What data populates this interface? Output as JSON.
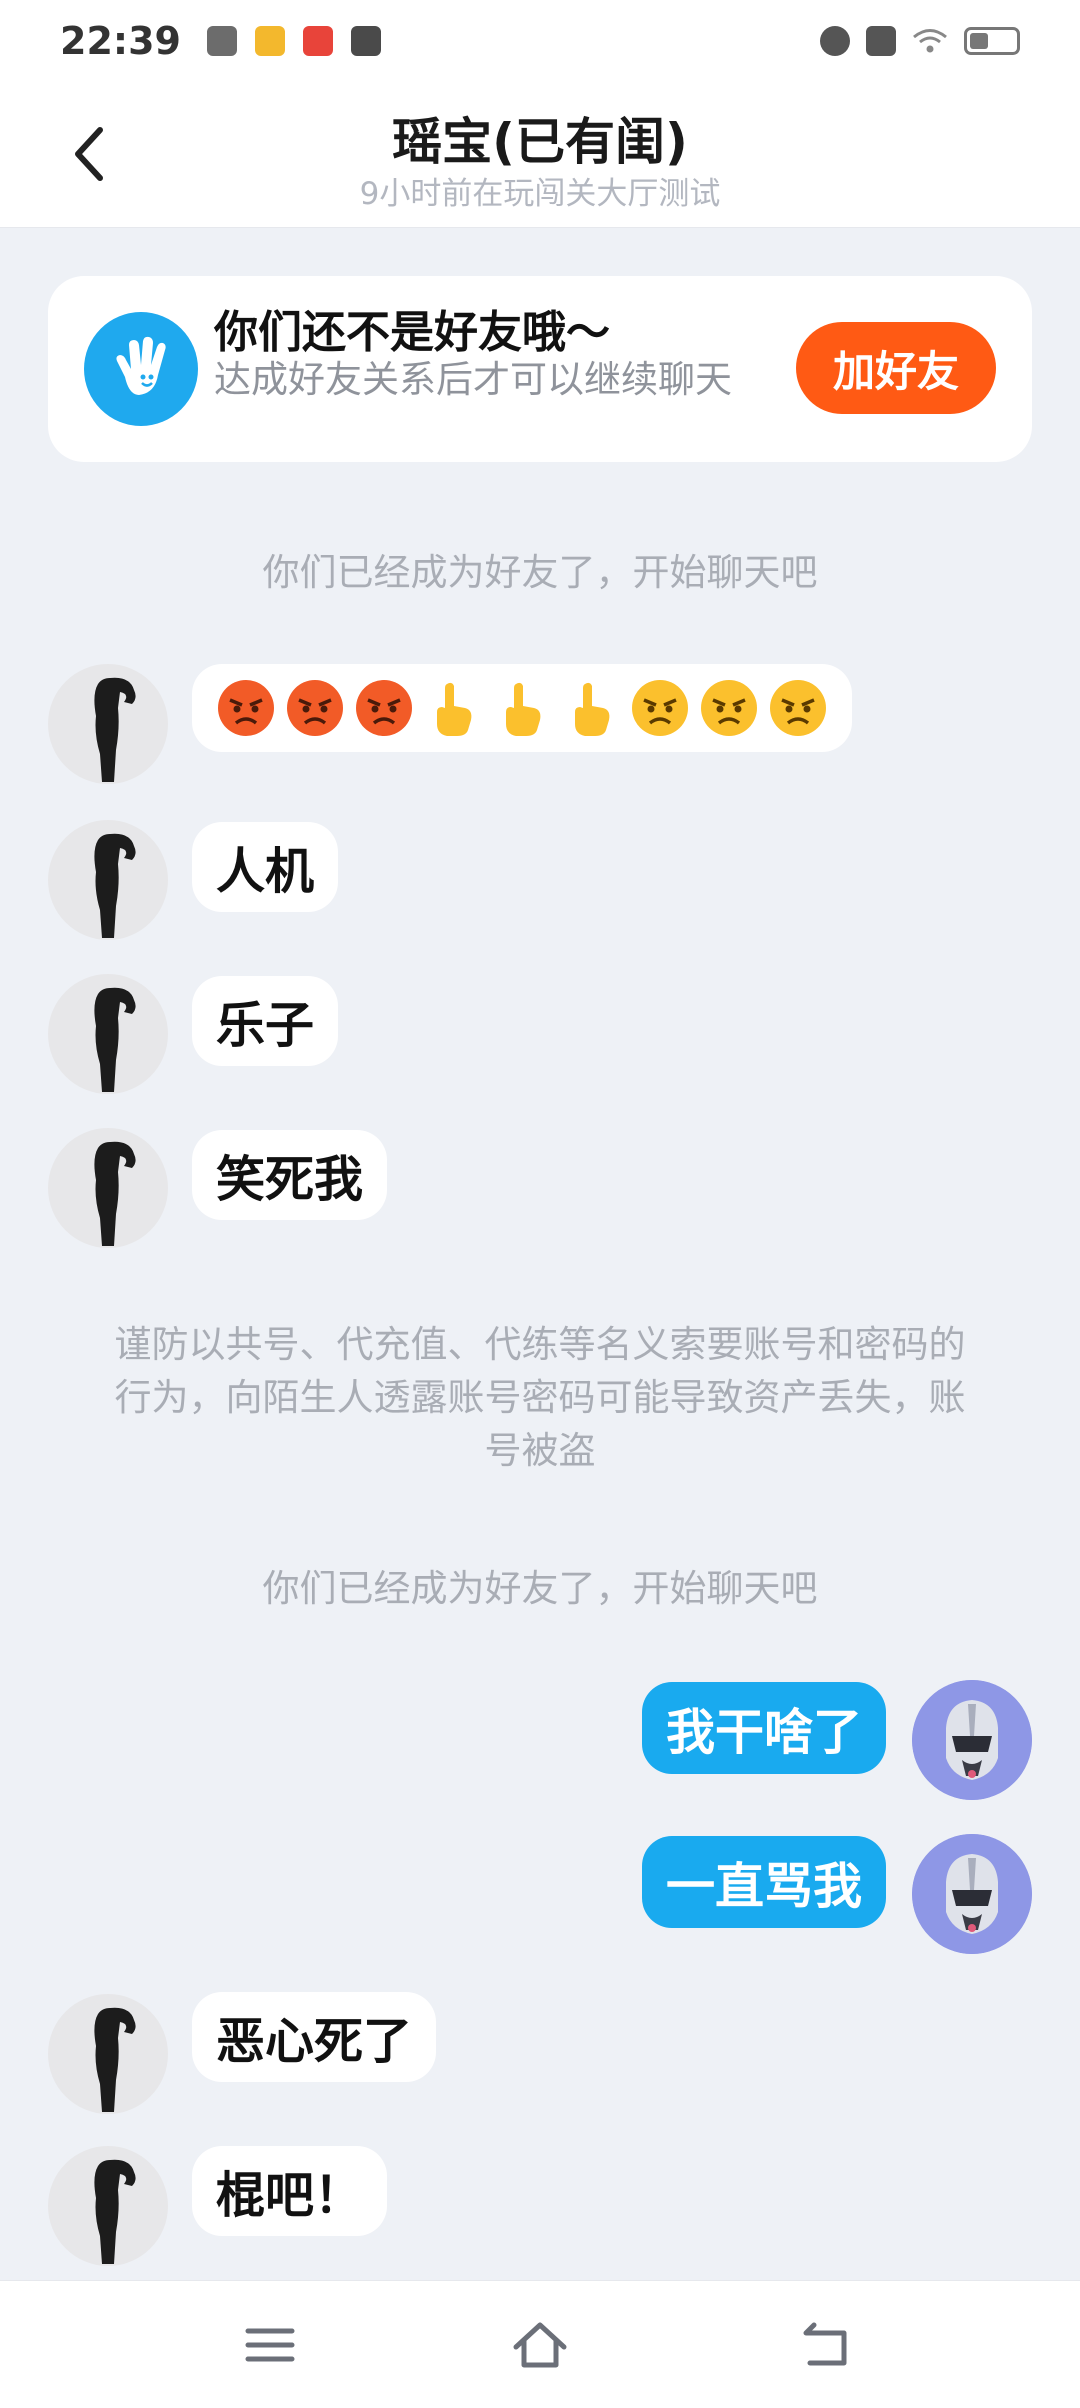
{
  "status_bar": {
    "time": "22:39",
    "battery_level": 0.35
  },
  "header": {
    "title": "瑶宝(已有闺)",
    "subtitle": "9小时前在玩闯关大厅测试"
  },
  "banner": {
    "title": "你们还不是好友哦～",
    "description": "达成好友关系后才可以继续聊天",
    "button": "加好友"
  },
  "notices": {
    "friends_1": "你们已经成为好友了，开始聊天吧",
    "warning": "谨防以共号、代充值、代练等名义索要账号和密码的行为，向陌生人透露账号密码可能导致资产丢失，账号被盗",
    "friends_2": "你们已经成为好友了，开始聊天吧"
  },
  "messages": [
    {
      "side": "left",
      "kind": "emoji",
      "emojis": [
        "angry-face",
        "angry-face",
        "angry-face",
        "pointing-up",
        "pointing-up",
        "pointing-up",
        "annoyed-face",
        "annoyed-face",
        "annoyed-face"
      ]
    },
    {
      "side": "left",
      "text": "人机"
    },
    {
      "side": "left",
      "text": "乐子"
    },
    {
      "side": "left",
      "text": "笑死我"
    },
    {
      "side": "right",
      "text": "我干啥了"
    },
    {
      "side": "right",
      "text": "一直骂我"
    },
    {
      "side": "left",
      "text": "恶心死了"
    },
    {
      "side": "left",
      "text": "棍吧！"
    }
  ],
  "colors": {
    "accent_blue": "#19aaef",
    "add_friend_orange": "#ff5a14",
    "background": "#eef1f6"
  },
  "nav": {
    "icons": [
      "menu-icon",
      "home-icon",
      "back-icon"
    ]
  }
}
